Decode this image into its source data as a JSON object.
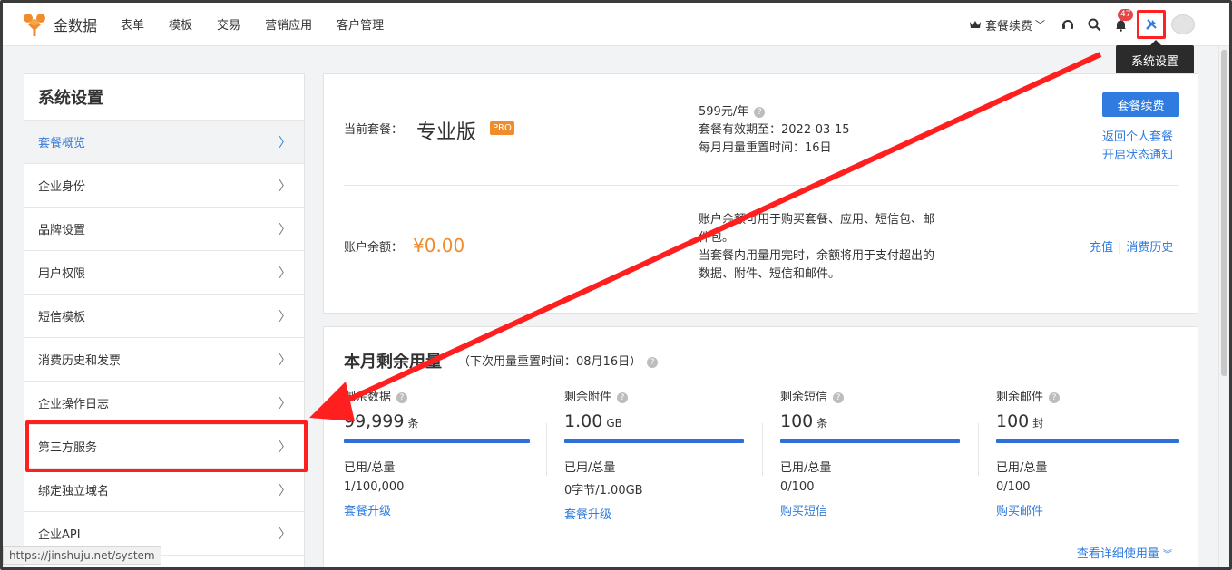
{
  "brand": {
    "name": "金数据"
  },
  "topnav": {
    "links": [
      "表单",
      "模板",
      "交易",
      "营销应用",
      "客户管理"
    ],
    "plan_renew_label": "套餐续费",
    "notification_count": "47",
    "settings_tooltip": "系统设置"
  },
  "sidebar": {
    "title": "系统设置",
    "items": [
      {
        "label": "套餐概览",
        "active": true
      },
      {
        "label": "企业身份"
      },
      {
        "label": "品牌设置"
      },
      {
        "label": "用户权限"
      },
      {
        "label": "短信模板"
      },
      {
        "label": "消费历史和发票"
      },
      {
        "label": "企业操作日志"
      },
      {
        "label": "第三方服务",
        "highlighted": true
      },
      {
        "label": "绑定独立域名"
      },
      {
        "label": "企业API"
      }
    ]
  },
  "plan": {
    "current_label": "当前套餐：",
    "name": "专业版",
    "badge": "PRO",
    "price": "599元/年",
    "expiry": "套餐有效期至：2022-03-15",
    "reset": "每月用量重置时间：16日",
    "renew_button": "套餐续费",
    "return_link": "返回个人套餐",
    "notify_link": "开启状态通知"
  },
  "balance": {
    "label": "账户余额：",
    "amount": "¥0.00",
    "desc_line1": "账户余额可用于购买套餐、应用、短信包、邮",
    "desc_line2": "件包。",
    "desc_line3": "当套餐内用量用完时，余额将用于支付超出的",
    "desc_line4": "数据、附件、短信和邮件。",
    "recharge_link": "充值",
    "history_link": "消费历史"
  },
  "usage": {
    "title": "本月剩余用量",
    "subtitle": "（下次用量重置时间：08月16日）",
    "columns": [
      {
        "name": "剩余数据",
        "value": "99,999",
        "unit": "条",
        "used_label": "已用/总量",
        "used_value": "1/100,000",
        "action": "套餐升级",
        "remaining_fraction": 0.99999
      },
      {
        "name": "剩余附件",
        "value": "1.00",
        "unit": "GB",
        "used_label": "已用/总量",
        "used_value": "0字节/1.00GB",
        "action": "套餐升级",
        "remaining_fraction": 1.0
      },
      {
        "name": "剩余短信",
        "value": "100",
        "unit": "条",
        "used_label": "已用/总量",
        "used_value": "0/100",
        "action": "购买短信",
        "remaining_fraction": 1.0
      },
      {
        "name": "剩余邮件",
        "value": "100",
        "unit": "封",
        "used_label": "已用/总量",
        "used_value": "0/100",
        "action": "购买邮件",
        "remaining_fraction": 1.0
      }
    ],
    "detail_link": "查看详细使用量"
  },
  "statusbar": {
    "url": "https://jinshuju.net/system"
  },
  "colors": {
    "accent": "#2f7bdf",
    "orange": "#f08c2b",
    "annotation_red": "#ff1f1f"
  }
}
